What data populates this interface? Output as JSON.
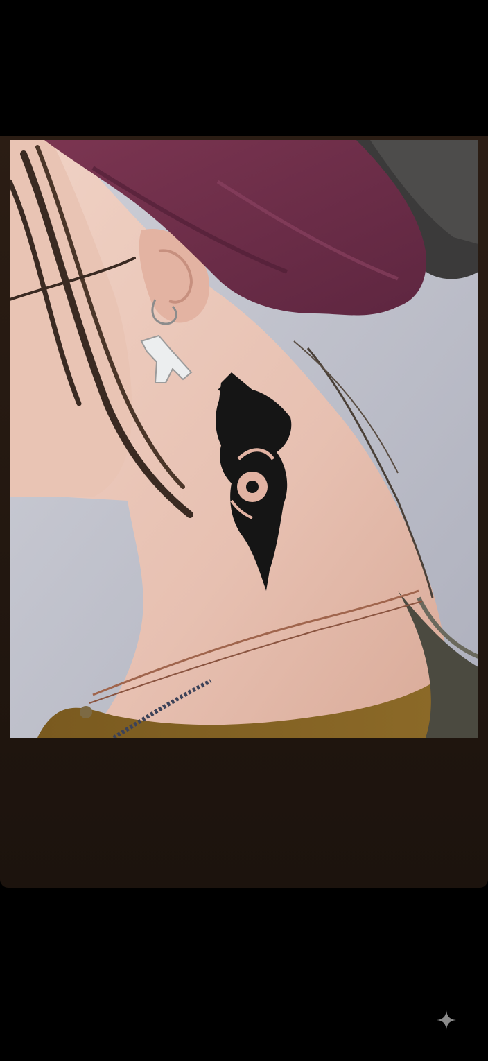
{
  "viewer": {
    "image_subject": "tribal-wolf-neck-tattoo-photo",
    "background_color": "#000000",
    "card_color": "#2b1d14"
  },
  "overlay": {
    "corner_icon": "sparkle-icon"
  }
}
